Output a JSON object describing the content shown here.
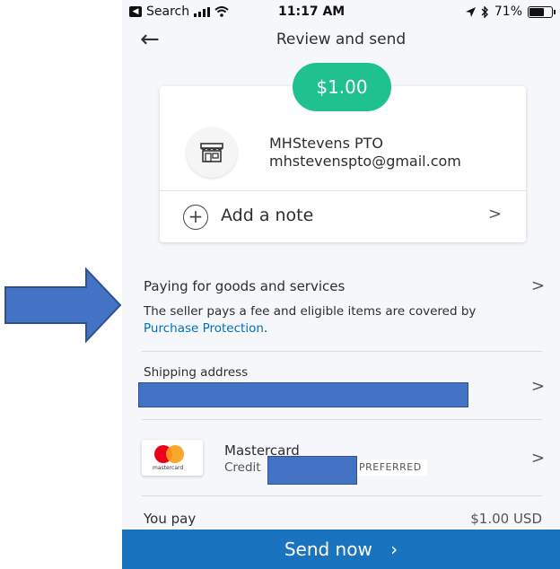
{
  "status_bar": {
    "back_app": "Search",
    "time": "11:17 AM",
    "battery": "71%",
    "battery_level": 0.71
  },
  "header": {
    "title": "Review and send"
  },
  "payment": {
    "amount": "$1.00",
    "payee_name": "MHStevens PTO",
    "payee_email": "mhstevenspto@gmail.com",
    "note_label": "Add a note"
  },
  "purchase_type": {
    "title": "Paying for goods and services",
    "description": "The seller pays a fee and eligible items are covered by",
    "link": "Purchase Protection",
    "after_link": "."
  },
  "shipping": {
    "label": "Shipping address"
  },
  "funding": {
    "card_name": "Mastercard",
    "card_type": "Credit",
    "badge": "PREFERRED",
    "card_logo_text": "mastercard"
  },
  "total": {
    "label": "You pay",
    "value": "$1.00 USD"
  },
  "send_button": {
    "label": "Send now",
    "chevron": "›"
  },
  "colors": {
    "accent_green": "#1fc18f",
    "primary_blue": "#1a73be",
    "link_blue": "#0070ba",
    "annotation_blue": "#4472c4"
  },
  "icons": [
    "back-arrow-icon",
    "store-icon",
    "plus-circle-icon",
    "chevron-right-icon",
    "signal-icon",
    "wifi-icon",
    "location-icon",
    "bluetooth-icon",
    "battery-icon"
  ]
}
